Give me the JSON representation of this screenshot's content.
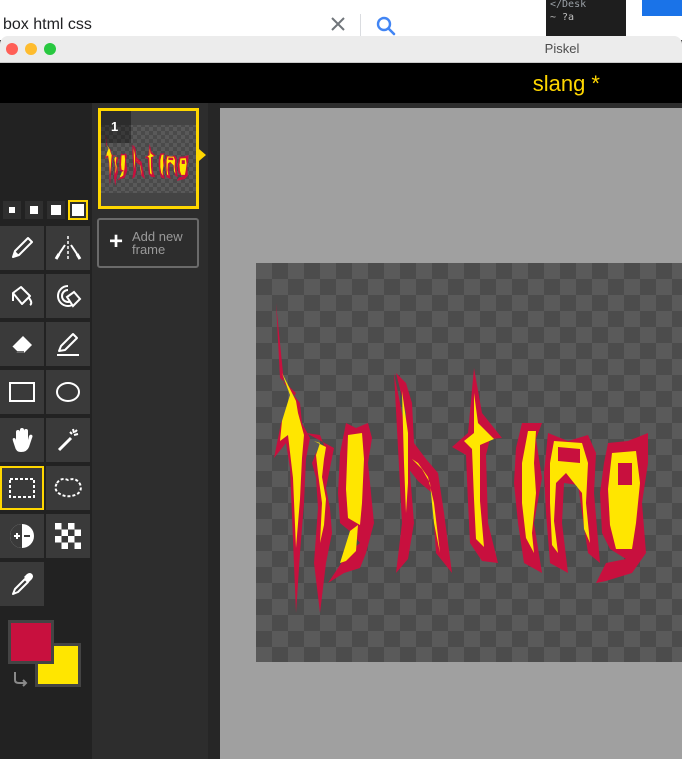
{
  "browser": {
    "search_query": "box html css",
    "editor_snippet": [
      "</Desk",
      "~  ?a"
    ]
  },
  "window": {
    "title": "Piskel"
  },
  "app": {
    "sprite_title": "slang *"
  },
  "frames": {
    "items": [
      {
        "number": "1"
      }
    ],
    "add_label": "Add new frame"
  },
  "tools": {
    "pen_sizes": [
      1,
      2,
      3,
      4
    ],
    "selected_pen_size": 4,
    "items": [
      {
        "name": "pen",
        "icon": "pencil-icon"
      },
      {
        "name": "vertical-mirror-pen",
        "icon": "mirror-pen-icon"
      },
      {
        "name": "paint-bucket",
        "icon": "bucket-icon"
      },
      {
        "name": "paint-all-same-color",
        "icon": "spiral-bucket-icon"
      },
      {
        "name": "eraser",
        "icon": "eraser-icon"
      },
      {
        "name": "stroke",
        "icon": "line-icon"
      },
      {
        "name": "rectangle",
        "icon": "rectangle-icon"
      },
      {
        "name": "circle",
        "icon": "ellipse-icon"
      },
      {
        "name": "move",
        "icon": "hand-icon"
      },
      {
        "name": "shape-selection",
        "icon": "magic-wand-icon"
      },
      {
        "name": "rectangle-selection",
        "icon": "dashed-rectangle-icon",
        "selected": true
      },
      {
        "name": "lasso-selection",
        "icon": "lasso-icon"
      },
      {
        "name": "lighten",
        "icon": "lighten-icon"
      },
      {
        "name": "dithering",
        "icon": "checker-icon"
      },
      {
        "name": "color-picker",
        "icon": "eyedropper-icon"
      }
    ]
  },
  "colors": {
    "primary": "#c8103e",
    "secondary": "#ffe600",
    "accent": "#ffd700"
  },
  "artwork": {
    "text": "lightning"
  }
}
